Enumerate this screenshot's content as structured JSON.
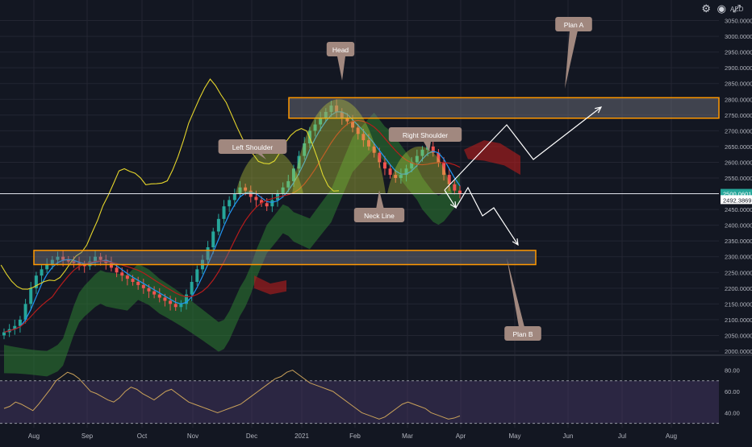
{
  "toolbar": {
    "currency": "AED",
    "icons": [
      "settings-icon",
      "camera-icon",
      "fullscreen-icon"
    ]
  },
  "colors": {
    "background": "#131722",
    "price_scale_bg": "#131722",
    "grid": "#232632",
    "up_candle": "#26a69a",
    "down_candle": "#ef5350",
    "ma_fast": "#2196f3",
    "ma_slow": "#b71c1c",
    "lagging_span": "#e5d52b",
    "cloud_bull": "#2e7d32",
    "cloud_bear": "#b71c1c",
    "zone_fill": "#787b86",
    "zone_border": "#ff9800",
    "callout": "#a1887f",
    "current_price_badge": "#26a69a",
    "rsi_line": "#c9a15a",
    "rsi_band": "#4a3a6b"
  },
  "chart_data": [
    {
      "type": "candlestick",
      "title": "",
      "ylim": [
        2000,
        3100
      ],
      "y_ticks": [
        "2000.0000",
        "2050.0000",
        "2100.0000",
        "2150.0000",
        "2200.0000",
        "2250.0000",
        "2300.0000",
        "2350.0000",
        "2400.0000",
        "2450.0000",
        "2500.0000",
        "2550.0000",
        "2600.0000",
        "2650.0000",
        "2700.0000",
        "2750.0000",
        "2800.0000",
        "2850.0000",
        "2900.0000",
        "2950.0000",
        "3000.0000",
        "3050.0000"
      ],
      "x_ticks": [
        "Aug",
        "Sep",
        "Oct",
        "Nov",
        "Dec",
        "2021",
        "Feb",
        "Mar",
        "Apr",
        "May",
        "Jun",
        "Jul",
        "Aug"
      ],
      "current_price": "2500.0601",
      "crosshair_price": "2492.3869",
      "price_series_close": [
        2060,
        2070,
        2080,
        2100,
        2150,
        2200,
        2240,
        2260,
        2275,
        2290,
        2300,
        2290,
        2285,
        2280,
        2275,
        2270,
        2285,
        2300,
        2290,
        2280,
        2265,
        2250,
        2240,
        2230,
        2220,
        2210,
        2200,
        2190,
        2180,
        2170,
        2160,
        2150,
        2140,
        2150,
        2180,
        2220,
        2260,
        2290,
        2330,
        2380,
        2420,
        2460,
        2480,
        2500,
        2520,
        2510,
        2490,
        2480,
        2470,
        2460,
        2480,
        2500,
        2520,
        2540,
        2580,
        2620,
        2660,
        2700,
        2720,
        2740,
        2760,
        2780,
        2760,
        2740,
        2730,
        2710,
        2690,
        2670,
        2650,
        2630,
        2600,
        2580,
        2560,
        2550,
        2560,
        2580,
        2600,
        2620,
        2640,
        2650,
        2630,
        2600,
        2560,
        2530,
        2510,
        2500
      ],
      "zones": [
        {
          "name": "resistance-zone",
          "low": 2740,
          "high": 2805
        },
        {
          "name": "support-zone",
          "low": 2275,
          "high": 2320
        }
      ],
      "annotations": [
        {
          "label": "Plan A"
        },
        {
          "label": "Head"
        },
        {
          "label": "Left Shoulder"
        },
        {
          "label": "Right Shoulder"
        },
        {
          "label": "Neck Line"
        },
        {
          "label": "Plan B"
        }
      ]
    },
    {
      "type": "line",
      "title": "",
      "ylim": [
        30,
        90
      ],
      "y_ticks": [
        "80.00",
        "60.00",
        "40.00"
      ],
      "levels": [
        70,
        30
      ],
      "values": [
        44,
        46,
        50,
        48,
        45,
        42,
        48,
        55,
        62,
        70,
        74,
        78,
        76,
        72,
        66,
        60,
        58,
        55,
        52,
        50,
        54,
        60,
        64,
        62,
        58,
        55,
        52,
        56,
        60,
        62,
        58,
        54,
        50,
        48,
        46,
        44,
        42,
        40,
        42,
        44,
        46,
        48,
        52,
        56,
        60,
        64,
        68,
        72,
        74,
        78,
        80,
        76,
        72,
        68,
        66,
        64,
        62,
        60,
        56,
        52,
        48,
        44,
        40,
        38,
        36,
        34,
        36,
        40,
        44,
        48,
        50,
        48,
        46,
        44,
        40,
        38,
        36,
        34,
        35,
        37
      ]
    }
  ]
}
